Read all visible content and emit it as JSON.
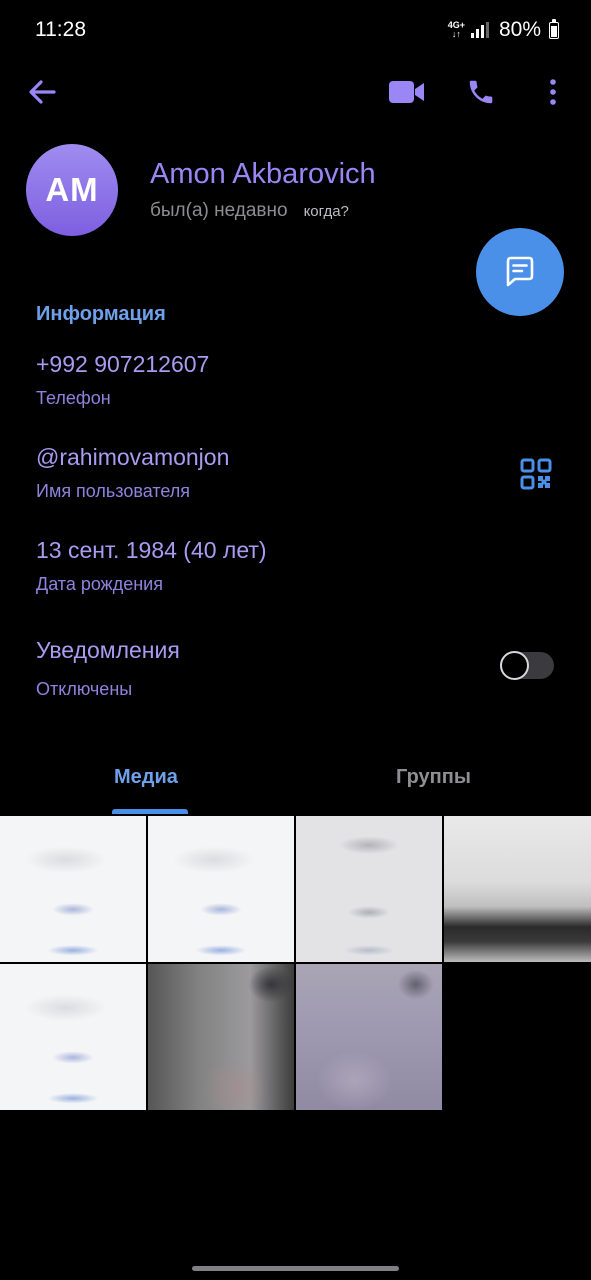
{
  "status_bar": {
    "time": "11:28",
    "network_top": "4G+",
    "network_bottom": "↓↑",
    "battery": "80%"
  },
  "toolbar": {
    "back_icon": "arrow-left-icon",
    "video_icon": "video-camera-icon",
    "call_icon": "phone-icon",
    "more_icon": "more-vertical-icon"
  },
  "profile": {
    "initials": "AM",
    "name": "Amon Akbarovich",
    "last_seen": "был(а) недавно",
    "when_link": "когда?",
    "fab_icon": "chat-message-icon"
  },
  "info": {
    "section_title": "Информация",
    "phone": "+992 907212607",
    "phone_label": "Телефон",
    "username": "@rahimovamonjon",
    "username_label": "Имя пользователя",
    "birthday": "13 сент. 1984 (40 лет)",
    "birthday_label": "Дата рождения",
    "notifications_title": "Уведомления",
    "notifications_status": "Отключены",
    "notifications_enabled": false
  },
  "tabs": {
    "media": "Медиа",
    "groups": "Группы",
    "active": "media"
  },
  "colors": {
    "accent_blue": "#4a8fe8",
    "accent_purple": "#9b86f5",
    "background": "#000000"
  }
}
